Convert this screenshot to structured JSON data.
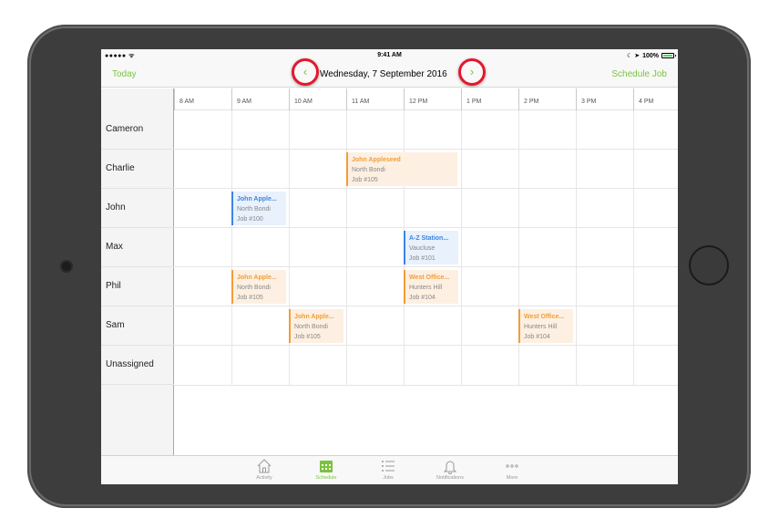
{
  "status": {
    "carrier": "●●●●● ᯤ",
    "time": "9:41 AM",
    "battery": "100%"
  },
  "nav": {
    "today": "Today",
    "date": "Wednesday, 7 September 2016",
    "schedule_job": "Schedule Job",
    "prev_arrow": "‹",
    "next_arrow": "›"
  },
  "hours": [
    "8 AM",
    "9 AM",
    "10 AM",
    "11 AM",
    "12 PM",
    "1 PM",
    "2 PM",
    "3 PM",
    "4 PM"
  ],
  "staff": [
    "Cameron",
    "Charlie",
    "John",
    "Max",
    "Phil",
    "Sam",
    "Unassigned"
  ],
  "jobs": [
    {
      "title": "John Appleseed",
      "location": "North Bondi",
      "job": "Job #105",
      "color": "orange"
    },
    {
      "title": "John Apple...",
      "location": "North Bondi",
      "job": "Job #100",
      "color": "blue"
    },
    {
      "title": "A-Z Station...",
      "location": "Vaucluse",
      "job": "Job #101",
      "color": "blue"
    },
    {
      "title": "John Apple...",
      "location": "North Bondi",
      "job": "Job #105",
      "color": "orange"
    },
    {
      "title": "West Office...",
      "location": "Hunters Hill",
      "job": "Job #104",
      "color": "orange"
    },
    {
      "title": "John Apple...",
      "location": "North Bondi",
      "job": "Job #105",
      "color": "orange"
    },
    {
      "title": "West Office...",
      "location": "Hunters Hill",
      "job": "Job #104",
      "color": "orange"
    }
  ],
  "tabs": [
    {
      "label": "Activity",
      "icon": "house-icon"
    },
    {
      "label": "Schedule",
      "icon": "calendar-icon"
    },
    {
      "label": "Jobs",
      "icon": "list-icon"
    },
    {
      "label": "Notifications",
      "icon": "bell-icon"
    },
    {
      "label": "More",
      "icon": "more-icon"
    }
  ],
  "colors": {
    "accent": "#7cc241",
    "orange": "#f29d38",
    "blue": "#3b86e0",
    "highlight_ring": "#e3182d"
  }
}
